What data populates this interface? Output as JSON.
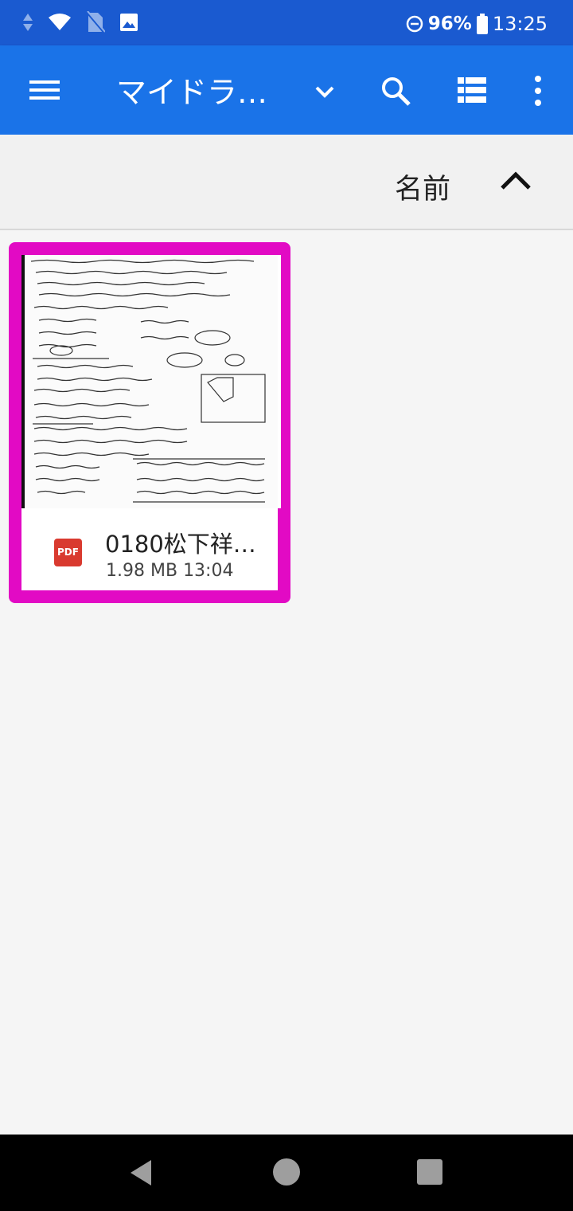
{
  "status_bar": {
    "battery": "96%",
    "time": "13:25"
  },
  "app_bar": {
    "title": "マイドラ…",
    "icons": [
      "menu-icon",
      "chevron-down-icon",
      "search-icon",
      "list-view-icon",
      "more-vert-icon"
    ],
    "color": "#1a73e8"
  },
  "sort_bar": {
    "label": "名前",
    "direction_icon": "chevron-up-icon"
  },
  "files": [
    {
      "name": "0180松下祥…",
      "size": "1.98 MB",
      "time": "13:04",
      "type_badge": "PDF",
      "highlight_color": "#e20ac4"
    }
  ],
  "nav_bar": {
    "icons": [
      "back-icon",
      "home-icon",
      "recents-icon"
    ]
  }
}
